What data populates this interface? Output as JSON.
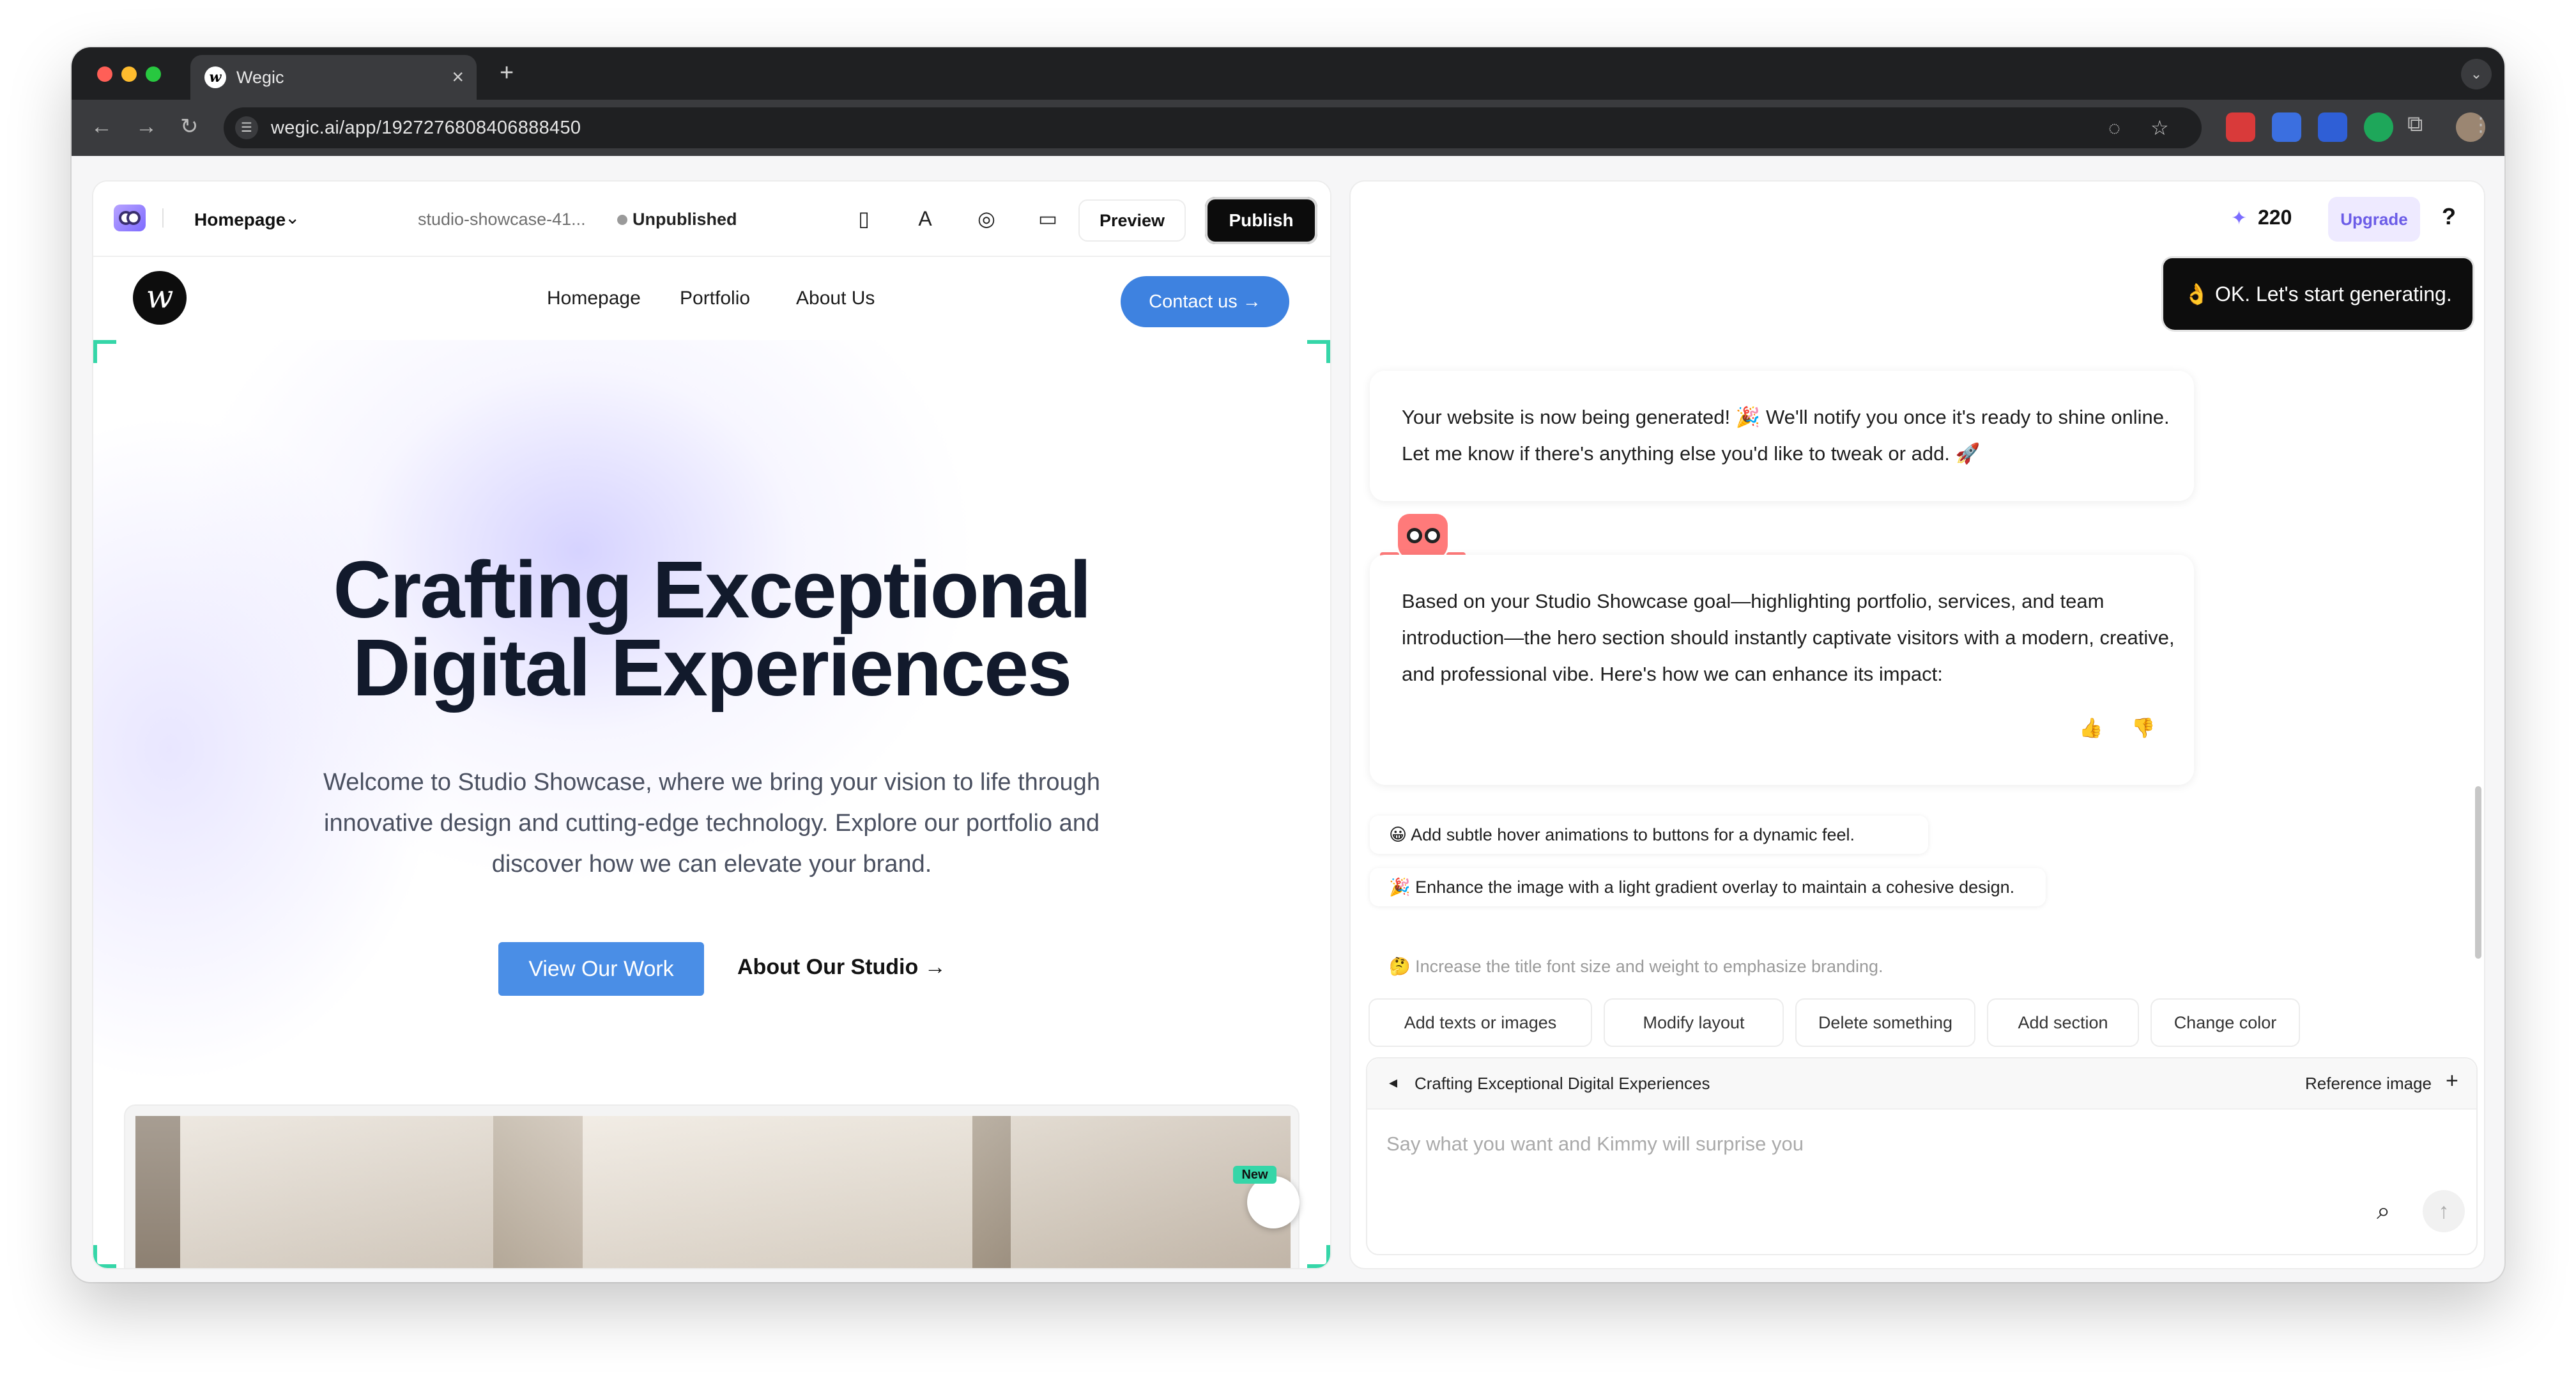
{
  "browser": {
    "tab_title": "Wegic",
    "tab_favicon": "w",
    "url": "wegic.ai/app/1927276808406888450",
    "icons": [
      "close-icon",
      "plus-icon",
      "back-icon",
      "forward-icon",
      "reload-icon",
      "site-settings-icon",
      "eye-off-icon",
      "star-icon",
      "extensions-icon",
      "profile-icon",
      "more-icon"
    ]
  },
  "editor": {
    "page_select": "Homepage",
    "slug": "studio-showcase-41...",
    "status": "Unpublished",
    "preview_label": "Preview",
    "publish_label": "Publish"
  },
  "site": {
    "logo_letter": "w",
    "nav": [
      "Homepage",
      "Portfolio",
      "About Us"
    ],
    "contact_label": "Contact us →",
    "hero_title_line1": "Crafting Exceptional",
    "hero_title_line2": "Digital Experiences",
    "hero_subtitle": "Welcome to Studio Showcase, where we bring your vision to life through innovative design and cutting-edge technology. Explore our portfolio and discover how we can elevate your brand.",
    "primary_cta": "View Our Work",
    "secondary_cta": "About Our Studio →",
    "new_badge": "New"
  },
  "chat": {
    "credits": "220",
    "upgrade_label": "Upgrade",
    "help_label": "?",
    "user_message": "👌 OK. Let's start generating.",
    "bot_message_1": "Your website is now being generated! 🎉 We'll notify you once it's ready to shine online. Let me know if there's anything else you'd like to tweak or add. 🚀",
    "bot_message_2": "Based on your Studio Showcase goal—highlighting portfolio, services, and team introduction—the hero section should instantly captivate visitors with a modern, creative, and professional vibe. Here's how we can enhance its impact:",
    "suggestions": [
      "😀 Add subtle hover animations to buttons for a dynamic feel.",
      "🎉 Enhance the image with a light gradient overlay to maintain a cohesive design.",
      "🤔 Increase the title font size and weight to emphasize branding."
    ],
    "quick_actions": [
      "Add texts or images",
      "Modify layout",
      "Delete something",
      "Add section",
      "Change color"
    ],
    "context_label": "Crafting Exceptional Digital Experiences",
    "reference_label": "Reference image",
    "input_placeholder": "Say what you want and Kimmy will surprise you"
  },
  "colors": {
    "accent_blue": "#3e82e0",
    "upgrade_purple": "#6b5ce7",
    "selection_green": "#35d6a8"
  }
}
